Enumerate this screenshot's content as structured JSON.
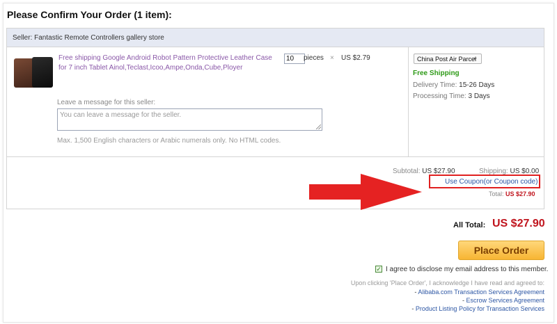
{
  "page": {
    "heading": "Please Confirm Your Order (1 item):"
  },
  "seller": {
    "label": "Seller: Fantastic Remote Controllers gallery store"
  },
  "item": {
    "title": "Free shipping Google Android Robot Pattern Protective Leather Case for 7 inch Tablet Ainol,Teclast,Icoo,Ampe,Onda,Cube,Ployer",
    "quantity": "10",
    "quantity_unit": "pieces",
    "times_symbol": "×",
    "unit_price": "US $2.79",
    "thumbnail_icon": "leather-case-thumbnail"
  },
  "shipping": {
    "method": "China Post Air Parcel",
    "free_label": "Free Shipping",
    "delivery_label": "Delivery Time:",
    "delivery_value": "15-26 Days",
    "processing_label": "Processing Time:",
    "processing_value": "3 Days"
  },
  "message": {
    "label": "Leave a message for this seller:",
    "placeholder": "You can leave a message for the seller.",
    "note": "Max. 1,500 English characters or Arabic numerals only. No HTML codes."
  },
  "summary": {
    "subtotal_label": "Subtotal:",
    "subtotal_value": "US $27.90",
    "shipping_label": "Shipping:",
    "shipping_value": "US $0.00",
    "coupon_link": "Use Coupon(or Coupon code)",
    "total_label": "Total:",
    "total_value": "US $27.90"
  },
  "checkout": {
    "all_total_label": "All Total:",
    "all_total_value": "US $27.90",
    "place_order": "Place Order",
    "agree_checked": true,
    "agree_text": "I agree to disclose my email address to this member.",
    "ack_text": "Upon clicking 'Place Order', I acknowledge I have read and agreed to:",
    "agreements": [
      "Alibaba.com Transaction Services Agreement",
      "Escrow Services Agreement",
      "Product Listing Policy for Transaction Services"
    ]
  },
  "colors": {
    "accent_red": "#c0141d",
    "annotation_red": "#e02020",
    "link_blue": "#2c56a4",
    "free_shipping_green": "#2e9a17",
    "button_orange": "#f7b533"
  }
}
